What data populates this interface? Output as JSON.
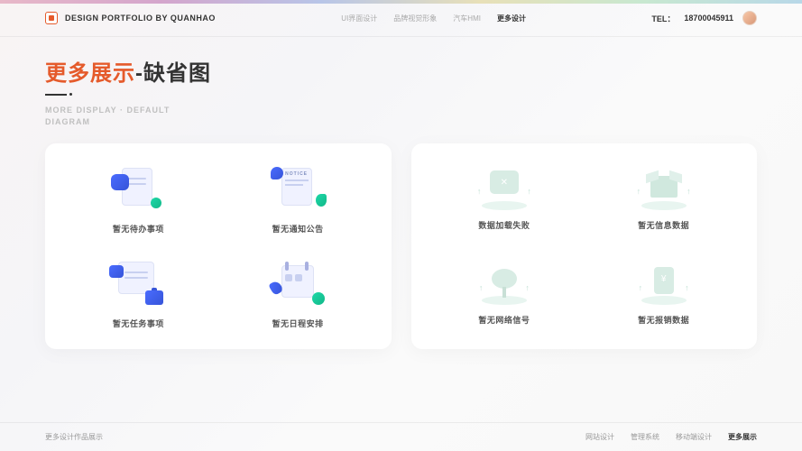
{
  "header": {
    "brand": "DESIGN PORTFOLIO BY QUANHAO",
    "nav": [
      "UI界面设计",
      "品牌视觉形象",
      "汽车HMI",
      "更多设计"
    ],
    "active_nav_index": 3,
    "tel_label": "TEL：",
    "tel": "18700045911"
  },
  "title": {
    "accent": "更多展示",
    "rest": "-缺省图",
    "subtitle_line1": "MORE DISPLAY · DEFAULT",
    "subtitle_line2": "DIAGRAM"
  },
  "left_cards": [
    {
      "label": "暂无待办事项",
      "icon": "todo"
    },
    {
      "label": "暂无通知公告",
      "icon": "notice"
    },
    {
      "label": "暂无任务事项",
      "icon": "task"
    },
    {
      "label": "暂无日程安排",
      "icon": "schedule"
    }
  ],
  "right_cards": [
    {
      "label": "数据加载失败",
      "icon": "load-fail"
    },
    {
      "label": "暂无信息数据",
      "icon": "empty-box"
    },
    {
      "label": "暂无网络信号",
      "icon": "no-signal"
    },
    {
      "label": "暂无报销数据",
      "icon": "no-receipt"
    }
  ],
  "footer": {
    "left": "更多设计作品展示",
    "links": [
      "网站设计",
      "管理系统",
      "移动端设计",
      "更多展示"
    ],
    "active_link_index": 3
  },
  "colors": {
    "accent": "#e55a2b",
    "blue": "#4a6cff",
    "green": "#1dd8a8"
  }
}
